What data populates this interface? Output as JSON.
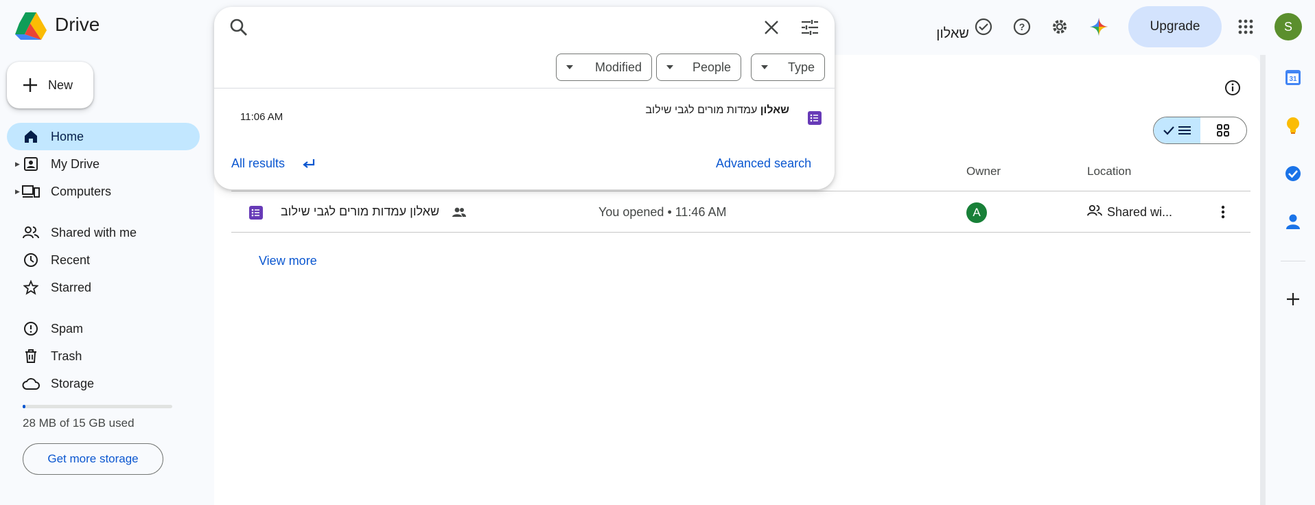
{
  "app": {
    "brand": "Drive"
  },
  "header": {
    "upgrade_label": "Upgrade",
    "avatar_letter": "S"
  },
  "search": {
    "query": "שאלון",
    "chips": [
      "Modified",
      "People",
      "Type"
    ],
    "result": {
      "time": "11:06 AM",
      "title_bold": "שאלון",
      "title_rest": " עמדות מורים לגבי שילוב"
    },
    "all_results_label": "All results",
    "advanced_label": "Advanced search"
  },
  "sidebar": {
    "new_label": "New",
    "items": [
      {
        "label": "Home"
      },
      {
        "label": "My Drive"
      },
      {
        "label": "Computers"
      },
      {
        "label": "Shared with me"
      },
      {
        "label": "Recent"
      },
      {
        "label": "Starred"
      },
      {
        "label": "Spam"
      },
      {
        "label": "Trash"
      },
      {
        "label": "Storage"
      }
    ],
    "storage_used": "28 MB of 15 GB used",
    "storage_fraction": 0.002,
    "get_storage_label": "Get more storage"
  },
  "table": {
    "headers": {
      "owner": "Owner",
      "location": "Location"
    },
    "rows": [
      {
        "name": "שאלון עמדות מורים לגבי שילוב",
        "activity": "You opened • 11:46 AM",
        "owner_letter": "A",
        "location": "Shared wi..."
      }
    ],
    "view_more_label": "View more"
  },
  "colors": {
    "accent": "#0b57d0",
    "selected": "#c2e7ff",
    "forms_purple": "#673ab7"
  }
}
